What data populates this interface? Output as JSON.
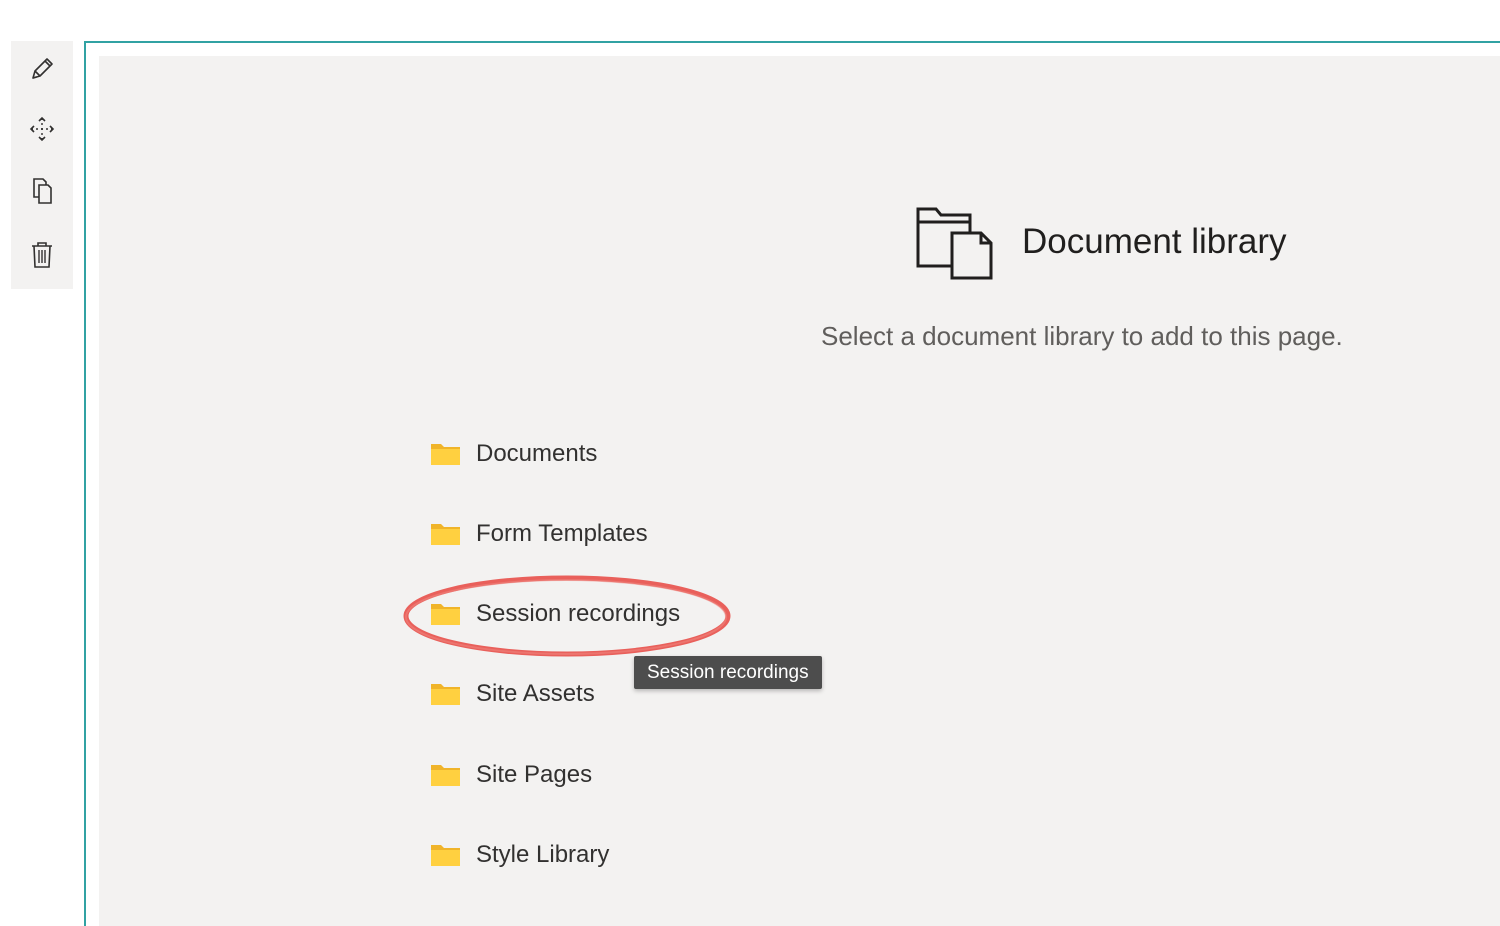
{
  "toolbar": {
    "items": [
      {
        "name": "edit-web-part",
        "icon": "pencil-icon"
      },
      {
        "name": "move-web-part",
        "icon": "move-icon"
      },
      {
        "name": "duplicate-web-part",
        "icon": "duplicate-icon"
      },
      {
        "name": "delete-web-part",
        "icon": "trash-icon"
      }
    ]
  },
  "placeholder": {
    "title": "Document library",
    "description": "Select a document library to add to this page.",
    "icon": "document-library-icon"
  },
  "libraries": [
    {
      "label": "Documents",
      "icon": "folder-icon"
    },
    {
      "label": "Form Templates",
      "icon": "folder-icon"
    },
    {
      "label": "Session recordings",
      "icon": "folder-icon",
      "highlighted": true
    },
    {
      "label": "Site Assets",
      "icon": "folder-icon"
    },
    {
      "label": "Site Pages",
      "icon": "folder-icon"
    },
    {
      "label": "Style Library",
      "icon": "folder-icon"
    }
  ],
  "tooltip": {
    "text": "Session recordings"
  },
  "colors": {
    "accent_border": "#31a2a3",
    "panel_background": "#f3f2f1",
    "folder_yellow": "#ffd040",
    "highlight_ring": "#e8504a",
    "tooltip_background": "#4d4d4d"
  }
}
